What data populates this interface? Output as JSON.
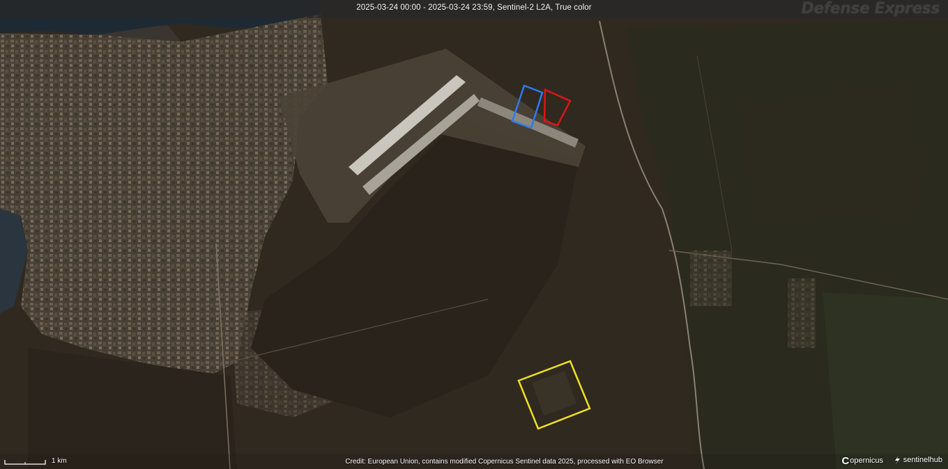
{
  "header": {
    "title": "2025-03-24 00:00 - 2025-03-24 23:59, Sentinel-2 L2A, True color"
  },
  "watermark": {
    "text": "Defense Express"
  },
  "footer": {
    "credit": "Credit: European Union, contains modified Copernicus Sentinel data 2025, processed with EO Browser",
    "scale_label": "1 km",
    "logo_copernicus": "opernicus",
    "logo_copernicus_initial": "C",
    "logo_sentinelhub": "sentinelhub"
  },
  "map": {
    "highlight_colors": {
      "blue": "#2b7bf0",
      "red": "#e01414",
      "yellow": "#f1e21c"
    },
    "icons": [
      "copernicus-logo-icon",
      "sentinelhub-logo-icon",
      "scale-bar-icon"
    ]
  }
}
